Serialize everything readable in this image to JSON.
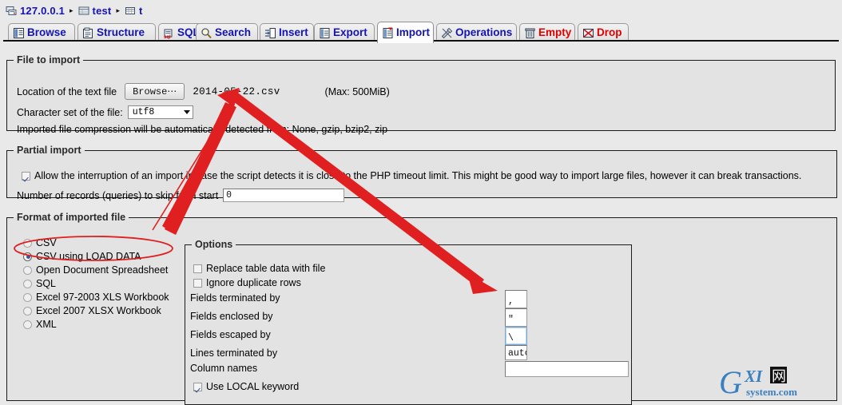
{
  "breadcrumb": {
    "separator": "▸",
    "items": [
      {
        "label": "127.0.0.1",
        "icon": "server-icon"
      },
      {
        "label": "test",
        "icon": "database-icon"
      },
      {
        "label": "t",
        "icon": "table-icon"
      }
    ]
  },
  "tabs": [
    {
      "label": "Browse",
      "icon": "browse-icon",
      "active": false,
      "danger": false
    },
    {
      "label": "Structure",
      "icon": "structure-icon",
      "active": false,
      "danger": false
    },
    {
      "label": "SQL",
      "icon": "sql-icon",
      "active": false,
      "danger": false
    },
    {
      "label": "Search",
      "icon": "search-icon",
      "active": false,
      "danger": false
    },
    {
      "label": "Insert",
      "icon": "insert-icon",
      "active": false,
      "danger": false
    },
    {
      "label": "Export",
      "icon": "export-icon",
      "active": false,
      "danger": false
    },
    {
      "label": "Import",
      "icon": "import-icon",
      "active": true,
      "danger": false
    },
    {
      "label": "Operations",
      "icon": "operations-icon",
      "active": false,
      "danger": false
    },
    {
      "label": "Empty",
      "icon": "empty-icon",
      "active": false,
      "danger": true
    },
    {
      "label": "Drop",
      "icon": "drop-icon",
      "active": false,
      "danger": true
    }
  ],
  "file_to_import": {
    "legend": "File to import",
    "location_label": "Location of the text file",
    "browse_button": "Browse⋯",
    "file_name": "2014-05-22.csv",
    "max_size": "(Max: 500MiB)",
    "charset_label": "Character set of the file:",
    "charset_value": "utf8",
    "compression_note": "Imported file compression will be automatically detected from: None, gzip, bzip2, zip"
  },
  "partial_import": {
    "legend": "Partial import",
    "allow_interruption_label": "Allow the interruption of an import in case the script detects it is close to the PHP timeout limit. This might be good way to import large files, however it can break transactions.",
    "allow_interruption_checked": true,
    "skip_label": "Number of records (queries) to skip from start",
    "skip_value": "0"
  },
  "format_of_imported_file": {
    "legend": "Format of imported file",
    "options": [
      {
        "label": "CSV",
        "selected": false
      },
      {
        "label": "CSV using LOAD DATA",
        "selected": true
      },
      {
        "label": "Open Document Spreadsheet",
        "selected": false
      },
      {
        "label": "SQL",
        "selected": false
      },
      {
        "label": "Excel 97-2003 XLS Workbook",
        "selected": false
      },
      {
        "label": "Excel 2007 XLSX Workbook",
        "selected": false
      },
      {
        "label": "XML",
        "selected": false
      }
    ]
  },
  "options": {
    "legend": "Options",
    "replace_label": "Replace table data with file",
    "replace_checked": false,
    "ignore_label": "Ignore duplicate rows",
    "ignore_checked": false,
    "fields_terminated_label": "Fields terminated by",
    "fields_terminated_value": ",",
    "fields_enclosed_label": "Fields enclosed by",
    "fields_enclosed_value": "\"",
    "fields_escaped_label": "Fields escaped by",
    "fields_escaped_value": "\\",
    "lines_terminated_label": "Lines terminated by",
    "lines_terminated_value": "auto",
    "column_names_label": "Column names",
    "column_names_value": "",
    "use_local_label": "Use LOCAL keyword",
    "use_local_checked": true
  },
  "annotations": {
    "highlight_color": "#e02020",
    "ellipse_target": "CSV using LOAD DATA",
    "arrow_1_target": "file_name",
    "arrow_2_target": "fields_terminated_by_input"
  },
  "watermark": {
    "big": "G",
    "mid": "XI",
    "box": "网",
    "small": "system.com",
    "color": "#3a7fc1"
  }
}
